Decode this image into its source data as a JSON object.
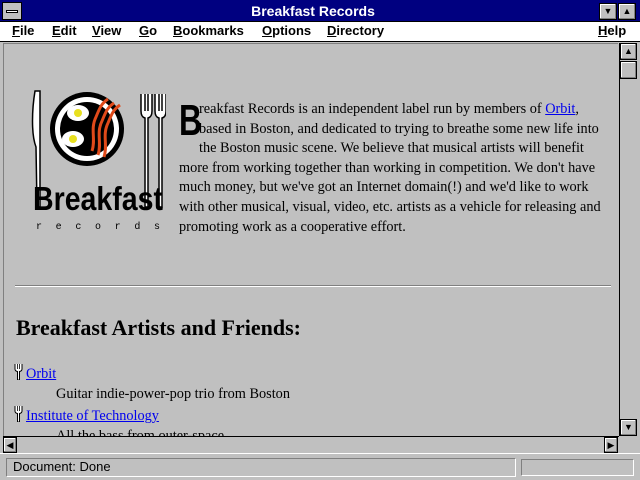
{
  "window": {
    "title": "Breakfast Records"
  },
  "menu": {
    "items": [
      {
        "label_ul": "F",
        "label_rest": "ile"
      },
      {
        "label_ul": "E",
        "label_rest": "dit"
      },
      {
        "label_ul": "V",
        "label_rest": "iew"
      },
      {
        "label_ul": "G",
        "label_rest": "o"
      },
      {
        "label_ul": "B",
        "label_rest": "ookmarks"
      },
      {
        "label_ul": "O",
        "label_rest": "ptions"
      },
      {
        "label_ul": "D",
        "label_rest": "irectory"
      },
      {
        "label_ul": "H",
        "label_rest": "elp"
      }
    ]
  },
  "logo": {
    "wordmark": "Breakfast",
    "subtitle": "records"
  },
  "intro": {
    "dropcap": "B",
    "text_before_link": "reakfast Records is an independent label run by members of ",
    "link_text": "Orbit",
    "text_after_link": ", based in Boston, and dedicated to trying to breathe some new life into the Boston music scene. We believe that musical artists will benefit more from working together than working in competition. We don't have much money, but we've got an Internet domain(!) and we'd like to work with other musical, visual, video, etc. artists as a vehicle for releasing and promoting work as a cooperative effort."
  },
  "artists_heading": "Breakfast Artists and Friends:",
  "artists": [
    {
      "name": "Orbit",
      "description": "Guitar indie-power-pop trio from Boston"
    },
    {
      "name": "Institute of Technology",
      "description": "All the bass from outer-space"
    }
  ],
  "status": {
    "text": "Document: Done"
  },
  "colors": {
    "titlebar": "#000080",
    "link": "#0000ee",
    "bacon": "#e04a1a"
  }
}
